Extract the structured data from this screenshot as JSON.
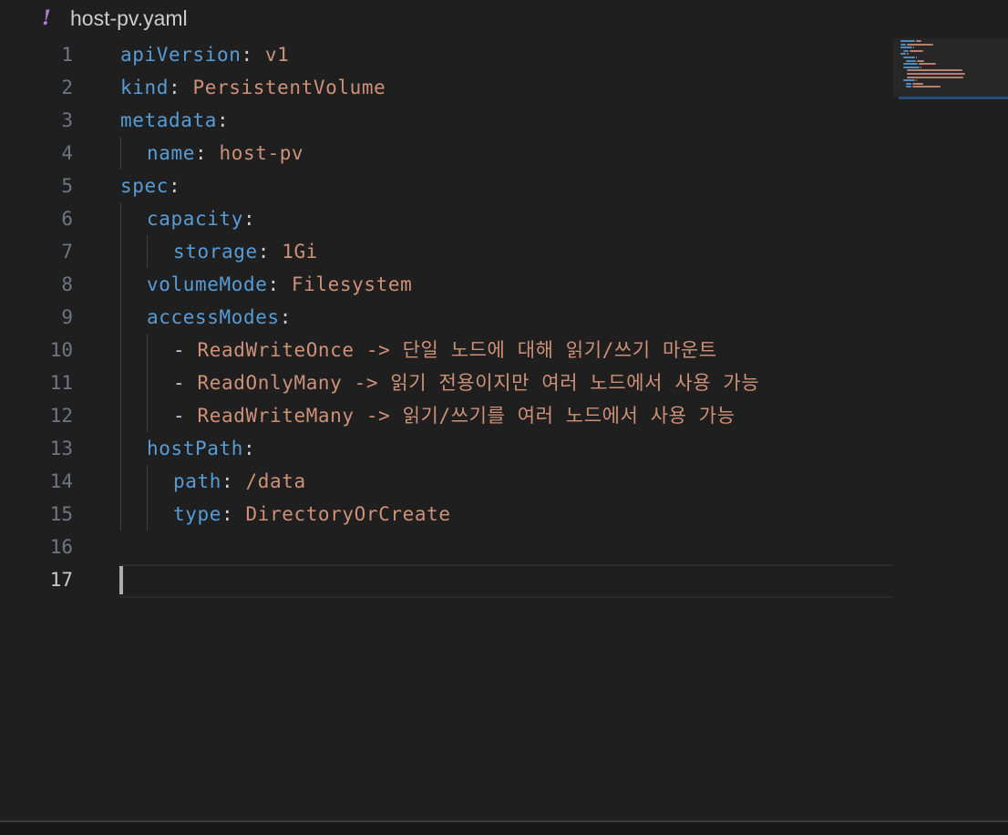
{
  "tab": {
    "icon": "yaml-file-icon",
    "icon_glyph": "!",
    "filename": "host-pv.yaml"
  },
  "colors": {
    "key": "#569cd6",
    "value": "#ce9178",
    "punctuation": "#cccccc",
    "line_number": "#6e7681",
    "active_line_number": "#cccccc",
    "file_icon": "#b180d7",
    "background": "#1f1f1f"
  },
  "editor": {
    "active_line": 17,
    "lines": [
      {
        "number": "1",
        "indent": 0,
        "key": "apiVersion",
        "sep": ":",
        "value": " v1"
      },
      {
        "number": "2",
        "indent": 0,
        "key": "kind",
        "sep": ":",
        "value": " PersistentVolume"
      },
      {
        "number": "3",
        "indent": 0,
        "key": "metadata",
        "sep": ":",
        "value": ""
      },
      {
        "number": "4",
        "indent": 1,
        "key": "name",
        "sep": ":",
        "value": " host-pv"
      },
      {
        "number": "5",
        "indent": 0,
        "key": "spec",
        "sep": ":",
        "value": ""
      },
      {
        "number": "6",
        "indent": 1,
        "key": "capacity",
        "sep": ":",
        "value": ""
      },
      {
        "number": "7",
        "indent": 2,
        "key": "storage",
        "sep": ":",
        "value": " 1Gi"
      },
      {
        "number": "8",
        "indent": 1,
        "key": "volumeMode",
        "sep": ":",
        "value": " Filesystem"
      },
      {
        "number": "9",
        "indent": 1,
        "key": "accessModes",
        "sep": ":",
        "value": ""
      },
      {
        "number": "10",
        "indent": 2,
        "key": "",
        "sep": "- ",
        "value": "ReadWriteOnce -> 단일 노드에 대해 읽기/쓰기 마운트"
      },
      {
        "number": "11",
        "indent": 2,
        "key": "",
        "sep": "- ",
        "value": "ReadOnlyMany -> 읽기 전용이지만 여러 노드에서 사용 가능"
      },
      {
        "number": "12",
        "indent": 2,
        "key": "",
        "sep": "- ",
        "value": "ReadWriteMany -> 읽기/쓰기를 여러 노드에서 사용 가능"
      },
      {
        "number": "13",
        "indent": 1,
        "key": "hostPath",
        "sep": ":",
        "value": ""
      },
      {
        "number": "14",
        "indent": 2,
        "key": "path",
        "sep": ":",
        "value": " /data"
      },
      {
        "number": "15",
        "indent": 2,
        "key": "type",
        "sep": ":",
        "value": " DirectoryOrCreate"
      },
      {
        "number": "16",
        "indent": 0,
        "key": "",
        "sep": "",
        "value": ""
      },
      {
        "number": "17",
        "indent": 0,
        "key": "",
        "sep": "",
        "value": ""
      }
    ]
  }
}
